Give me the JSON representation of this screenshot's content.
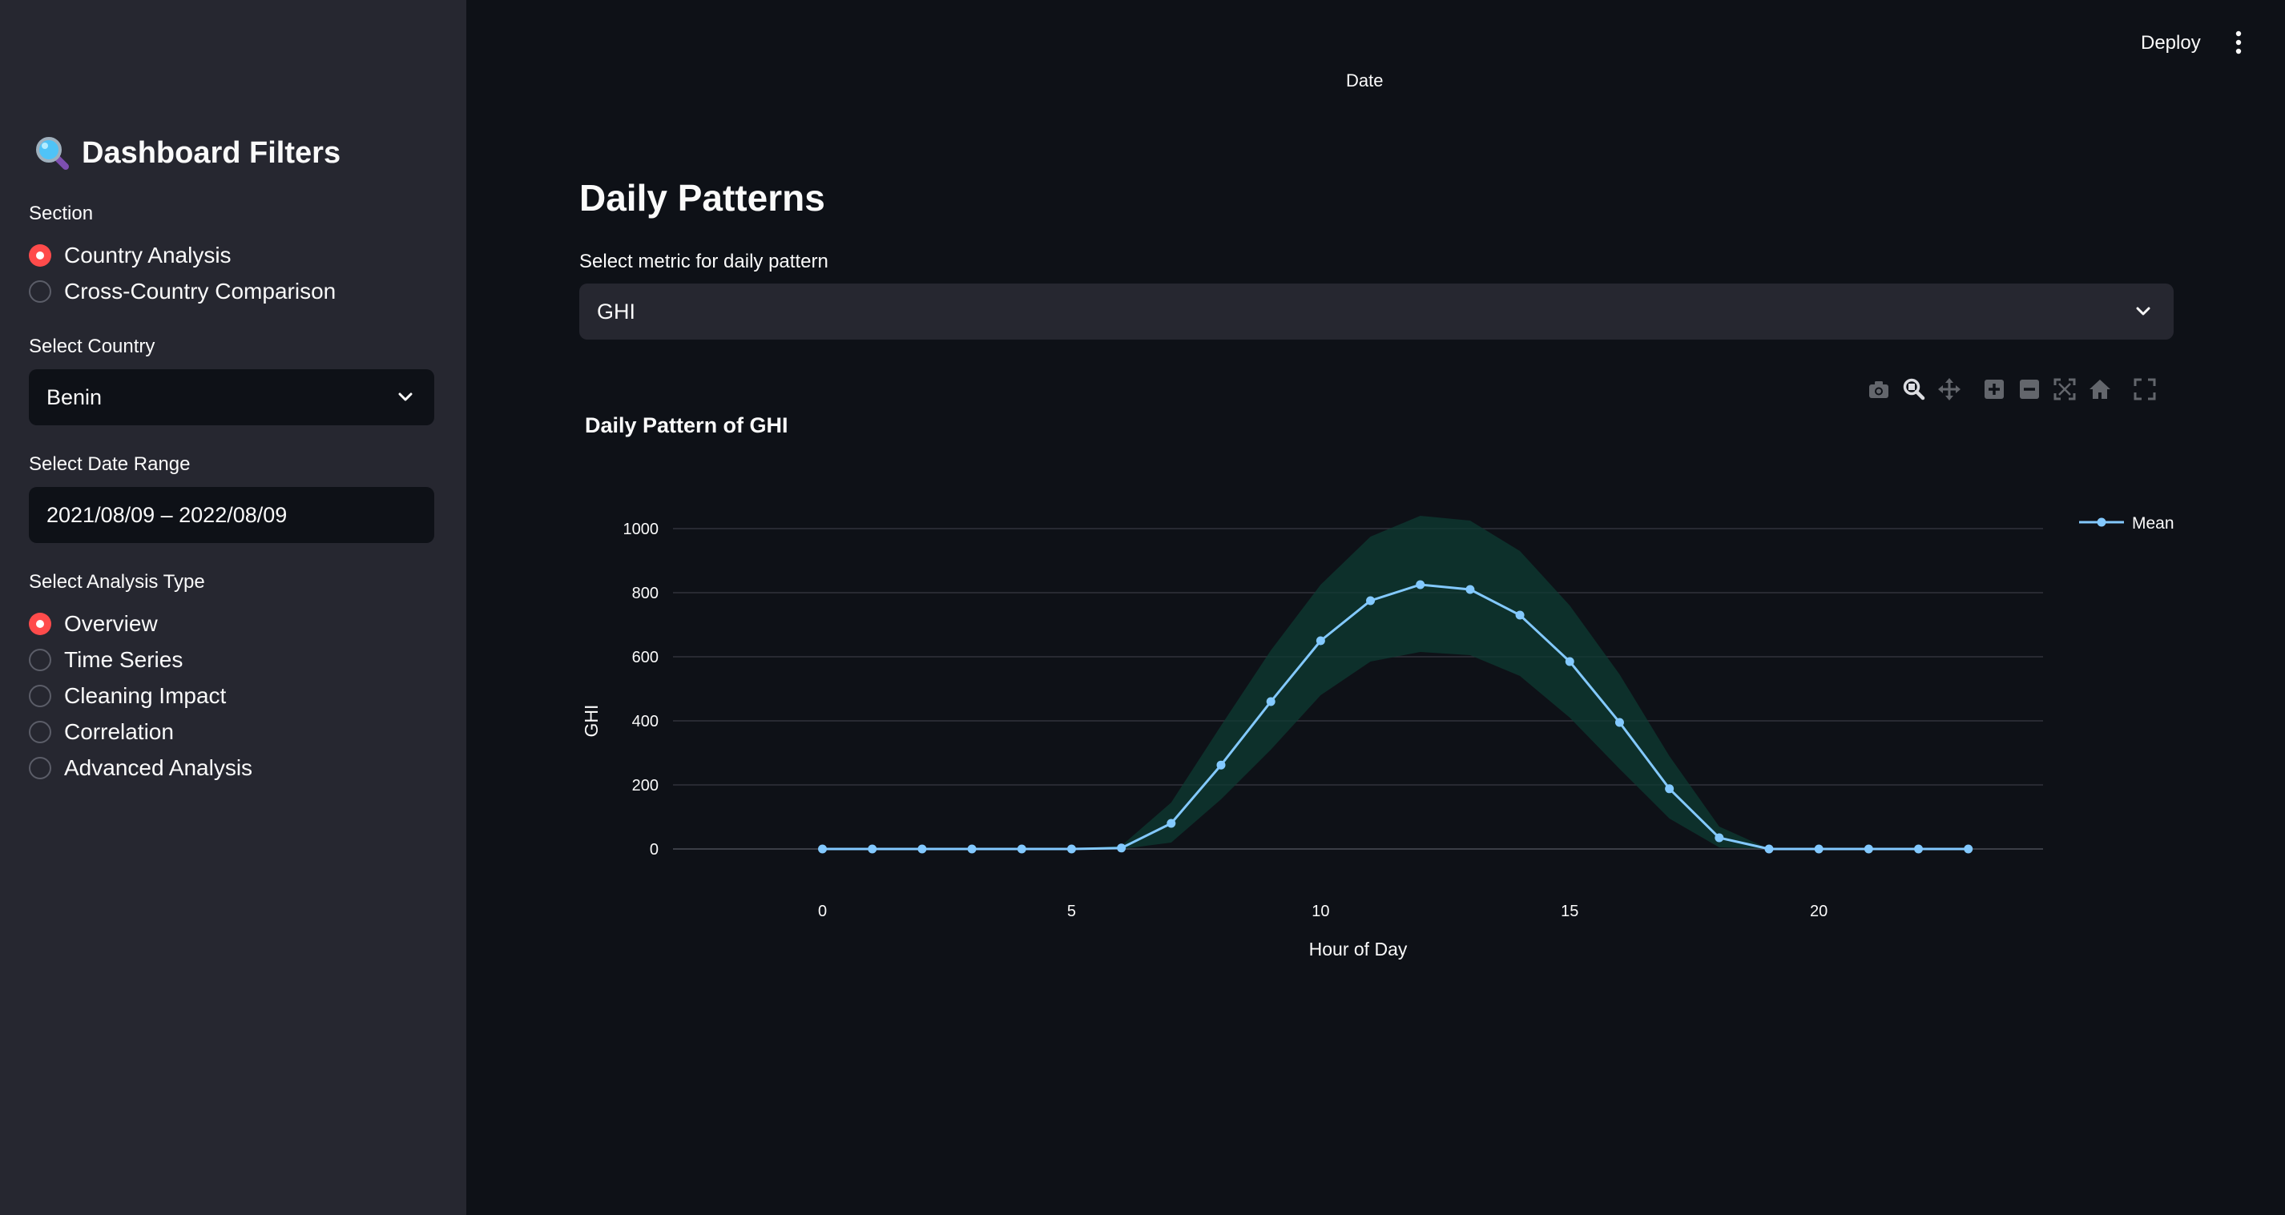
{
  "header": {
    "deploy_label": "Deploy",
    "top_axis_label": "Date"
  },
  "sidebar": {
    "title": "Dashboard Filters",
    "title_icon": "magnifying-glass-icon",
    "section": {
      "label": "Section",
      "options": [
        "Country Analysis",
        "Cross-Country Comparison"
      ],
      "selected": "Country Analysis"
    },
    "country": {
      "label": "Select Country",
      "value": "Benin"
    },
    "date_range": {
      "label": "Select Date Range",
      "value": "2021/08/09 – 2022/08/09"
    },
    "analysis": {
      "label": "Select Analysis Type",
      "options": [
        "Overview",
        "Time Series",
        "Cleaning Impact",
        "Correlation",
        "Advanced Analysis"
      ],
      "selected": "Overview"
    }
  },
  "main": {
    "title": "Daily Patterns",
    "metric_label": "Select metric for daily pattern",
    "metric_value": "GHI"
  },
  "modebar_icons": [
    "camera-icon",
    "zoom-icon",
    "pan-icon",
    "zoom-in-icon",
    "zoom-out-icon",
    "autoscale-icon",
    "reset-axes-icon",
    "fullscreen-icon"
  ],
  "colors": {
    "accent": "#ff4b4b",
    "line": "#83c9ff",
    "band": "#0d3b33",
    "sidebar": "#262730",
    "background": "#0e1117"
  },
  "chart_data": {
    "type": "line",
    "title": "Daily Pattern of GHI",
    "xlabel": "Hour of Day",
    "ylabel": "GHI",
    "xlim": [
      -3,
      24.5
    ],
    "ylim": [
      -50,
      1100
    ],
    "xticks": [
      0,
      5,
      10,
      15,
      20
    ],
    "yticks": [
      0,
      200,
      400,
      600,
      800,
      1000
    ],
    "grid": "horizontal",
    "legend_position": "top-right",
    "x": [
      0,
      1,
      2,
      3,
      4,
      5,
      6,
      7,
      8,
      9,
      10,
      11,
      12,
      13,
      14,
      15,
      16,
      17,
      18,
      19,
      20,
      21,
      22,
      23
    ],
    "series": [
      {
        "name": "Mean",
        "values": [
          0,
          0,
          0,
          0,
          0,
          0,
          3,
          80,
          262,
          460,
          650,
          775,
          825,
          810,
          730,
          585,
          395,
          188,
          35,
          0,
          0,
          0,
          0,
          0
        ]
      }
    ],
    "band": {
      "upper": [
        0,
        0,
        0,
        0,
        0,
        0,
        10,
        145,
        385,
        620,
        825,
        975,
        1040,
        1025,
        930,
        760,
        545,
        290,
        70,
        0,
        0,
        0,
        0,
        0
      ],
      "lower": [
        0,
        0,
        0,
        0,
        0,
        0,
        0,
        20,
        155,
        310,
        480,
        585,
        615,
        605,
        540,
        410,
        250,
        95,
        5,
        0,
        0,
        0,
        0,
        0
      ]
    }
  }
}
